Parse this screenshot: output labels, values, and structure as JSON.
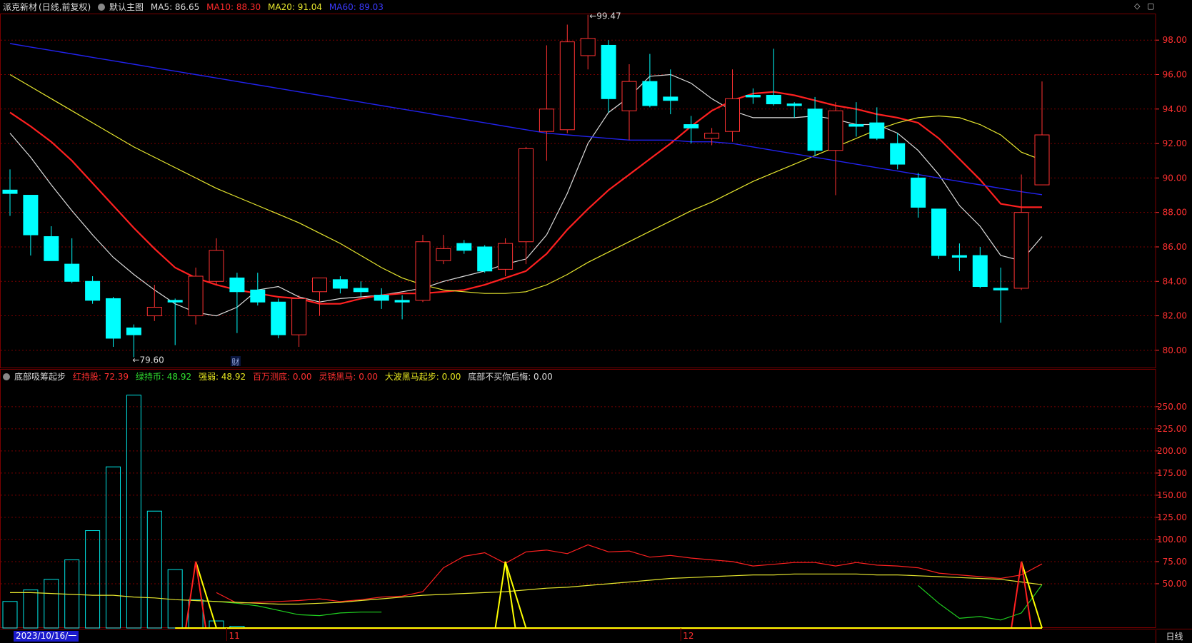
{
  "header": {
    "stock_name": "派克新材",
    "period_mode": "(日线,前复权)",
    "main_chart_label": "默认主图",
    "ma5_text": "MA5: 86.65",
    "ma10_text": "MA10: 88.30",
    "ma20_text": "MA20: 91.04",
    "ma60_text": "MA60: 89.03"
  },
  "indicator_header": {
    "name": "底部吸筹起步",
    "items": [
      {
        "label": "红持股: 72.39",
        "color": "#ff3030"
      },
      {
        "label": "绿持币: 48.92",
        "color": "#30e030"
      },
      {
        "label": "强弱: 48.92",
        "color": "#e8e820"
      },
      {
        "label": "百万测底: 0.00",
        "color": "#ff3030"
      },
      {
        "label": "灵锈黑马: 0.00",
        "color": "#ff3030"
      },
      {
        "label": "大波黑马起步: 0.00",
        "color": "#e8e820"
      },
      {
        "label": "底部不买你后悔: 0.00",
        "color": "#dddddd"
      }
    ]
  },
  "footer": {
    "date_label": "2023/10/16/一",
    "period_button": "日线",
    "month_labels": [
      "11",
      "12"
    ],
    "cai_marker": "财"
  },
  "colors": {
    "up": "#ff3232",
    "down": "#00ffff",
    "ma5": "#dddddd",
    "ma10": "#ff2020",
    "ma20": "#e6e62e",
    "ma60": "#2222ee",
    "grid": "#7a0000",
    "axis_text": "#ff3030"
  },
  "chart_data": [
    {
      "type": "candlestick",
      "title": "派克新材 (日线,前复权)",
      "ylim": [
        79,
        99.5
      ],
      "yticks": [
        80,
        82,
        84,
        86,
        88,
        90,
        92,
        94,
        96,
        98
      ],
      "max_label": "99.47",
      "min_label": "79.60",
      "candles": [
        {
          "o": 89.3,
          "c": 89.1,
          "h": 90.5,
          "l": 87.8
        },
        {
          "o": 89.0,
          "c": 86.7,
          "h": 89.0,
          "l": 85.5
        },
        {
          "o": 86.6,
          "c": 85.2,
          "h": 87.2,
          "l": 85.2
        },
        {
          "o": 85.0,
          "c": 84.0,
          "h": 86.5,
          "l": 83.9
        },
        {
          "o": 84.0,
          "c": 82.9,
          "h": 84.3,
          "l": 82.7
        },
        {
          "o": 83.0,
          "c": 80.7,
          "h": 83.1,
          "l": 80.2
        },
        {
          "o": 81.3,
          "c": 80.9,
          "h": 81.5,
          "l": 79.6
        },
        {
          "o": 82.0,
          "c": 82.5,
          "h": 83.8,
          "l": 81.7
        },
        {
          "o": 82.9,
          "c": 82.8,
          "h": 83.0,
          "l": 80.3
        },
        {
          "o": 82.0,
          "c": 84.3,
          "h": 84.8,
          "l": 81.5
        },
        {
          "o": 84.0,
          "c": 85.8,
          "h": 86.5,
          "l": 83.8
        },
        {
          "o": 84.2,
          "c": 83.4,
          "h": 84.5,
          "l": 81.0
        },
        {
          "o": 83.5,
          "c": 82.8,
          "h": 84.5,
          "l": 82.6
        },
        {
          "o": 82.8,
          "c": 80.9,
          "h": 83.0,
          "l": 80.7
        },
        {
          "o": 80.9,
          "c": 83.0,
          "h": 83.2,
          "l": 80.2
        },
        {
          "o": 83.4,
          "c": 84.2,
          "h": 84.2,
          "l": 82.0
        },
        {
          "o": 84.1,
          "c": 83.6,
          "h": 84.3,
          "l": 83.3
        },
        {
          "o": 83.6,
          "c": 83.4,
          "h": 84.0,
          "l": 83.1
        },
        {
          "o": 83.2,
          "c": 82.9,
          "h": 83.6,
          "l": 82.4
        },
        {
          "o": 82.9,
          "c": 82.8,
          "h": 83.2,
          "l": 81.8
        },
        {
          "o": 82.9,
          "c": 86.3,
          "h": 86.7,
          "l": 82.8
        },
        {
          "o": 85.2,
          "c": 85.9,
          "h": 86.7,
          "l": 85.0
        },
        {
          "o": 86.2,
          "c": 85.8,
          "h": 86.4,
          "l": 85.6
        },
        {
          "o": 86.0,
          "c": 84.6,
          "h": 86.1,
          "l": 84.5
        },
        {
          "o": 84.7,
          "c": 86.2,
          "h": 86.5,
          "l": 84.3
        },
        {
          "o": 86.3,
          "c": 91.7,
          "h": 91.8,
          "l": 85.0
        },
        {
          "o": 92.7,
          "c": 94.0,
          "h": 97.7,
          "l": 91.0
        },
        {
          "o": 92.8,
          "c": 97.9,
          "h": 98.9,
          "l": 92.6
        },
        {
          "o": 97.1,
          "c": 98.1,
          "h": 99.47,
          "l": 96.3
        },
        {
          "o": 97.7,
          "c": 94.6,
          "h": 98.0,
          "l": 93.8
        },
        {
          "o": 93.9,
          "c": 95.6,
          "h": 96.6,
          "l": 92.2
        },
        {
          "o": 95.6,
          "c": 94.2,
          "h": 97.2,
          "l": 94.1
        },
        {
          "o": 94.7,
          "c": 94.5,
          "h": 96.3,
          "l": 93.7
        },
        {
          "o": 93.1,
          "c": 92.9,
          "h": 93.6,
          "l": 92.0
        },
        {
          "o": 92.3,
          "c": 92.6,
          "h": 92.9,
          "l": 91.9
        },
        {
          "o": 92.7,
          "c": 94.6,
          "h": 96.3,
          "l": 92.1
        },
        {
          "o": 94.8,
          "c": 94.7,
          "h": 95.2,
          "l": 94.3
        },
        {
          "o": 94.8,
          "c": 94.3,
          "h": 97.5,
          "l": 94.2
        },
        {
          "o": 94.3,
          "c": 94.2,
          "h": 94.4,
          "l": 93.5
        },
        {
          "o": 94.0,
          "c": 91.6,
          "h": 94.7,
          "l": 91.3
        },
        {
          "o": 91.6,
          "c": 93.9,
          "h": 94.4,
          "l": 89.0
        },
        {
          "o": 93.1,
          "c": 93.0,
          "h": 94.4,
          "l": 92.4
        },
        {
          "o": 93.2,
          "c": 92.3,
          "h": 94.1,
          "l": 92.2
        },
        {
          "o": 92.0,
          "c": 90.8,
          "h": 92.6,
          "l": 90.5
        },
        {
          "o": 90.0,
          "c": 88.3,
          "h": 90.3,
          "l": 87.7
        },
        {
          "o": 88.2,
          "c": 85.5,
          "h": 88.2,
          "l": 85.3
        },
        {
          "o": 85.5,
          "c": 85.4,
          "h": 86.2,
          "l": 84.6
        },
        {
          "o": 85.5,
          "c": 83.7,
          "h": 86.0,
          "l": 83.6
        },
        {
          "o": 83.6,
          "c": 83.5,
          "h": 84.8,
          "l": 81.6
        },
        {
          "o": 83.6,
          "c": 88.0,
          "h": 90.2,
          "l": 83.5
        },
        {
          "o": 89.6,
          "c": 92.5,
          "h": 95.6,
          "l": 89.6
        }
      ],
      "series": [
        {
          "name": "MA5",
          "values": [
            92.6,
            91.2,
            89.6,
            88.1,
            86.7,
            85.4,
            84.4,
            83.5,
            82.7,
            82.2,
            82.0,
            82.5,
            83.5,
            83.7,
            83.1,
            82.8,
            83.0,
            83.1,
            83.2,
            83.4,
            83.6,
            84.0,
            84.3,
            84.6,
            85.0,
            85.3,
            86.7,
            89.1,
            92.0,
            93.8,
            94.7,
            95.9,
            96.0,
            95.5,
            94.6,
            93.9,
            93.5,
            93.5,
            93.5,
            93.6,
            93.4,
            93.1,
            93.1,
            92.6,
            91.6,
            90.2,
            88.4,
            87.2,
            85.5,
            85.2,
            86.6
          ]
        },
        {
          "name": "MA10",
          "values": [
            93.8,
            93.0,
            92.1,
            91.0,
            89.7,
            88.4,
            87.1,
            85.9,
            84.8,
            84.2,
            83.8,
            83.5,
            83.3,
            83.1,
            83.0,
            82.7,
            82.7,
            83.0,
            83.2,
            83.3,
            83.3,
            83.4,
            83.5,
            83.8,
            84.2,
            84.6,
            85.6,
            87.0,
            88.2,
            89.3,
            90.2,
            91.1,
            92.0,
            93.0,
            93.9,
            94.5,
            94.9,
            95.0,
            94.8,
            94.5,
            94.2,
            94.0,
            93.7,
            93.5,
            93.2,
            92.3,
            91.1,
            89.9,
            88.5,
            88.3,
            88.3
          ]
        },
        {
          "name": "MA20",
          "values": [
            96.0,
            95.3,
            94.6,
            93.9,
            93.2,
            92.5,
            91.8,
            91.2,
            90.6,
            90.0,
            89.4,
            88.9,
            88.4,
            87.9,
            87.4,
            86.8,
            86.2,
            85.5,
            84.8,
            84.2,
            83.8,
            83.5,
            83.4,
            83.3,
            83.3,
            83.4,
            83.8,
            84.4,
            85.1,
            85.7,
            86.3,
            86.9,
            87.5,
            88.1,
            88.6,
            89.2,
            89.8,
            90.3,
            90.8,
            91.3,
            91.8,
            92.3,
            92.8,
            93.2,
            93.5,
            93.6,
            93.5,
            93.1,
            92.5,
            91.5,
            91.04
          ]
        },
        {
          "name": "MA60",
          "values": [
            97.8,
            97.6,
            97.4,
            97.2,
            97.0,
            96.8,
            96.6,
            96.4,
            96.2,
            96.0,
            95.8,
            95.6,
            95.4,
            95.2,
            95.0,
            94.8,
            94.6,
            94.4,
            94.2,
            94.0,
            93.8,
            93.6,
            93.4,
            93.2,
            93.0,
            92.8,
            92.6,
            92.5,
            92.4,
            92.3,
            92.2,
            92.2,
            92.2,
            92.1,
            92.1,
            92.0,
            91.8,
            91.6,
            91.4,
            91.2,
            91.0,
            90.8,
            90.6,
            90.4,
            90.2,
            90.0,
            89.8,
            89.6,
            89.4,
            89.2,
            89.03
          ]
        }
      ]
    },
    {
      "type": "bar",
      "title": "底部吸筹起步",
      "ylim": [
        0,
        270
      ],
      "yticks": [
        50,
        75,
        100,
        125,
        150,
        175,
        200,
        225,
        250
      ],
      "bars": [
        30,
        43,
        55,
        77,
        110,
        182,
        263,
        132,
        66,
        32,
        8,
        2,
        0,
        0,
        0,
        0,
        0,
        0,
        0,
        0,
        0,
        0,
        0,
        0,
        0,
        0,
        0,
        0,
        0,
        0,
        0,
        0,
        0,
        0,
        0,
        0,
        0,
        0,
        0,
        0,
        0,
        0,
        0,
        0,
        0,
        0,
        0,
        0,
        0,
        0,
        0
      ],
      "series": [
        {
          "name": "红持股",
          "values": [
            null,
            null,
            null,
            null,
            null,
            null,
            null,
            null,
            null,
            null,
            40,
            28,
            29,
            30,
            31,
            33,
            30,
            32,
            35,
            36,
            41,
            68,
            81,
            85,
            73,
            86,
            88,
            84,
            94,
            86,
            87,
            80,
            82,
            79,
            77,
            75,
            70,
            72,
            74,
            74,
            70,
            74,
            71,
            70,
            68,
            62,
            60,
            58,
            56,
            60,
            72.39
          ]
        },
        {
          "name": "绿持币",
          "values": [
            null,
            null,
            null,
            null,
            null,
            null,
            null,
            null,
            null,
            31,
            30,
            28,
            25,
            20,
            15,
            14,
            17,
            18,
            18,
            null,
            null,
            null,
            null,
            null,
            null,
            null,
            null,
            null,
            null,
            null,
            null,
            null,
            null,
            null,
            null,
            null,
            null,
            null,
            null,
            null,
            null,
            null,
            null,
            null,
            48,
            28,
            11,
            13,
            9,
            17,
            48.92
          ]
        },
        {
          "name": "强弱",
          "values": [
            40,
            40,
            39,
            38,
            37,
            37,
            35,
            34,
            32,
            31,
            30,
            29,
            28,
            27,
            27,
            28,
            29,
            31,
            33,
            35,
            37,
            38,
            39,
            40,
            41,
            43,
            45,
            46,
            48,
            50,
            52,
            54,
            56,
            57,
            58,
            59,
            60,
            60,
            61,
            61,
            61,
            61,
            60,
            60,
            59,
            58,
            57,
            56,
            55,
            52,
            48.92
          ]
        },
        {
          "name": "底部不买你后悔",
          "values": [
            null,
            null,
            null,
            null,
            null,
            null,
            null,
            null,
            null,
            75,
            0,
            null,
            null,
            null,
            null,
            null,
            null,
            null,
            null,
            null,
            null,
            null,
            null,
            null,
            75,
            0,
            null,
            null,
            null,
            null,
            null,
            null,
            null,
            null,
            null,
            null,
            null,
            null,
            null,
            null,
            null,
            null,
            null,
            null,
            null,
            null,
            null,
            null,
            null,
            75,
            0
          ]
        }
      ]
    }
  ]
}
